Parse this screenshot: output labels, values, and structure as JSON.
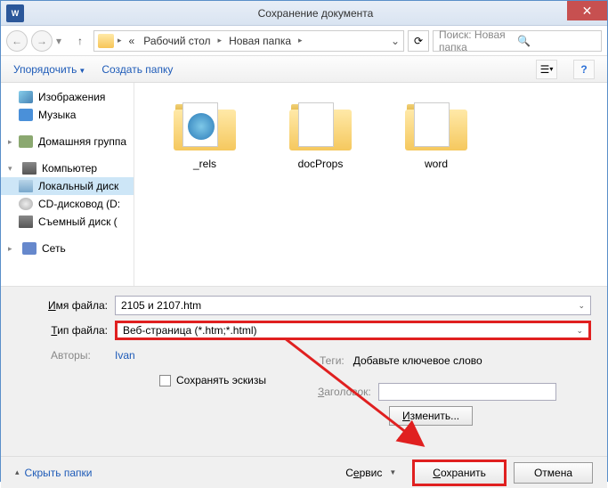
{
  "window": {
    "title": "Сохранение документа"
  },
  "breadcrumb": {
    "items": [
      "Рабочий стол",
      "Новая папка"
    ]
  },
  "search": {
    "placeholder": "Поиск: Новая папка"
  },
  "toolbar": {
    "organize": "Упорядочить",
    "newfolder": "Создать папку"
  },
  "sidebar": {
    "items": [
      {
        "label": "Изображения"
      },
      {
        "label": "Музыка"
      },
      {
        "label": "Домашняя группа"
      },
      {
        "label": "Компьютер"
      },
      {
        "label": "Локальный диск"
      },
      {
        "label": "CD-дисковод (D:"
      },
      {
        "label": "Съемный диск ("
      },
      {
        "label": "Сеть"
      }
    ]
  },
  "folders": [
    {
      "name": "_rels",
      "has_globe": true
    },
    {
      "name": "docProps",
      "has_globe": false
    },
    {
      "name": "word",
      "has_globe": false
    }
  ],
  "form": {
    "filename_label": "Имя файла:",
    "filename_value": "2105 и 2107.htm",
    "filetype_label": "Тип файла:",
    "filetype_value": "Веб-страница (*.htm;*.html)",
    "authors_label": "Авторы:",
    "authors_value": "Ivan",
    "tags_label": "Теги:",
    "tags_value": "Добавьте ключевое слово",
    "save_thumb": "Сохранять эскизы",
    "title_label": "Заголовок:",
    "change_btn": "Изменить..."
  },
  "footer": {
    "hide_folders": "Скрыть папки",
    "service": "Сервис",
    "save": "Сохранить",
    "cancel": "Отмена"
  }
}
